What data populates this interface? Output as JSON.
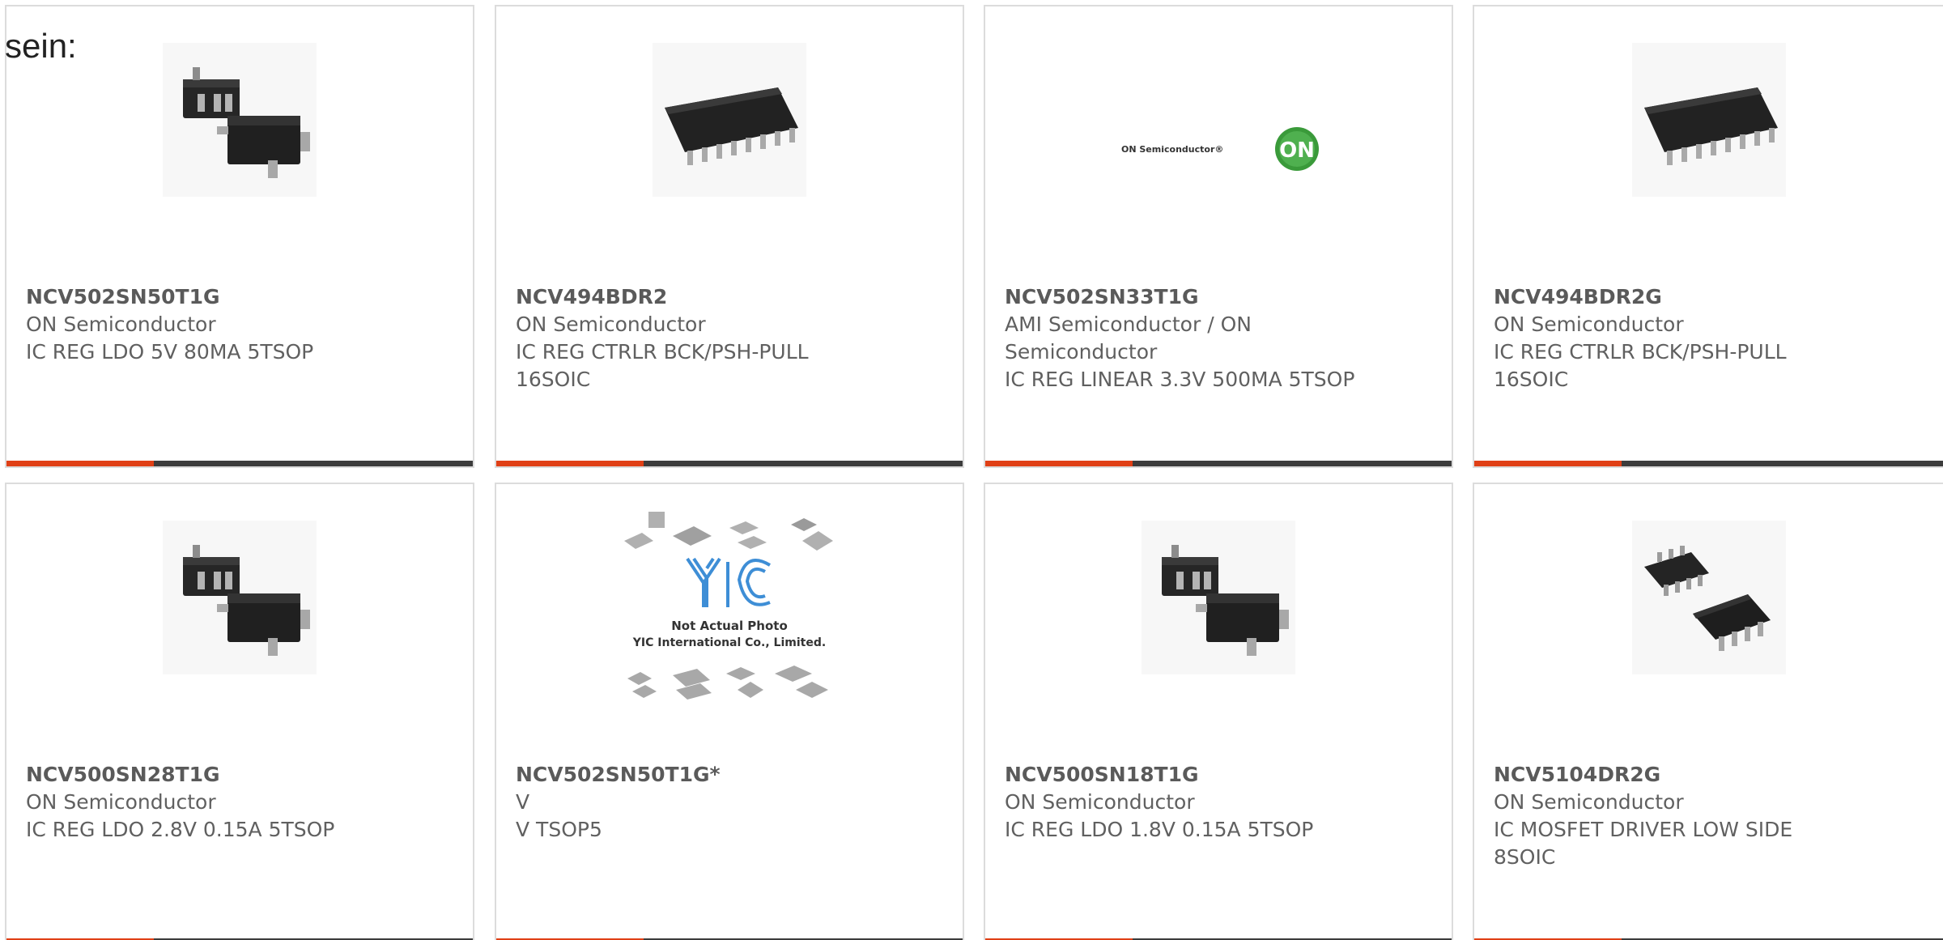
{
  "lead_text": "sein:",
  "colors": {
    "accent": "#e04016",
    "bar": "#3c3c3c",
    "border": "#dcdcdc",
    "text": "#606060"
  },
  "products": [
    {
      "part": "NCV502SN50T1G",
      "maker": "ON Semiconductor",
      "desc": "IC REG LDO 5V 80MA 5TSOP",
      "image": "sot23-5-package-icon"
    },
    {
      "part": "NCV494BDR2",
      "maker": "ON Semiconductor",
      "desc": "IC REG CTRLR BCK/PSH-PULL 16SOIC",
      "image": "soic16-package-icon"
    },
    {
      "part": "NCV502SN33T1G",
      "maker": "AMI Semiconductor / ON Semiconductor",
      "desc": "IC REG LINEAR 3.3V 500MA 5TSOP",
      "image": "on-semiconductor-logo"
    },
    {
      "part": "NCV494BDR2G",
      "maker": "ON Semiconductor",
      "desc": "IC REG CTRLR BCK/PSH-PULL 16SOIC",
      "image": "soic16-package-icon"
    },
    {
      "part": "NCV500SN28T1G",
      "maker": "ON Semiconductor",
      "desc": "IC REG LDO 2.8V 0.15A 5TSOP",
      "image": "sot23-5-package-icon"
    },
    {
      "part": "NCV502SN50T1G*",
      "maker": "V",
      "desc": "V TSOP5",
      "image": "not-actual-photo-placeholder"
    },
    {
      "part": "NCV500SN18T1G",
      "maker": "ON Semiconductor",
      "desc": "IC REG LDO 1.8V 0.15A 5TSOP",
      "image": "sot23-5-package-icon"
    },
    {
      "part": "NCV5104DR2G",
      "maker": "ON Semiconductor",
      "desc": "IC MOSFET DRIVER LOW SIDE 8SOIC",
      "image": "soic8-package-icon"
    }
  ],
  "logo": {
    "wordmark": "ON Semiconductor®",
    "badge": "ON"
  },
  "placeholder": {
    "brand": "YIC",
    "line1": "Not Actual Photo",
    "line2": "YIC International Co., Limited."
  }
}
